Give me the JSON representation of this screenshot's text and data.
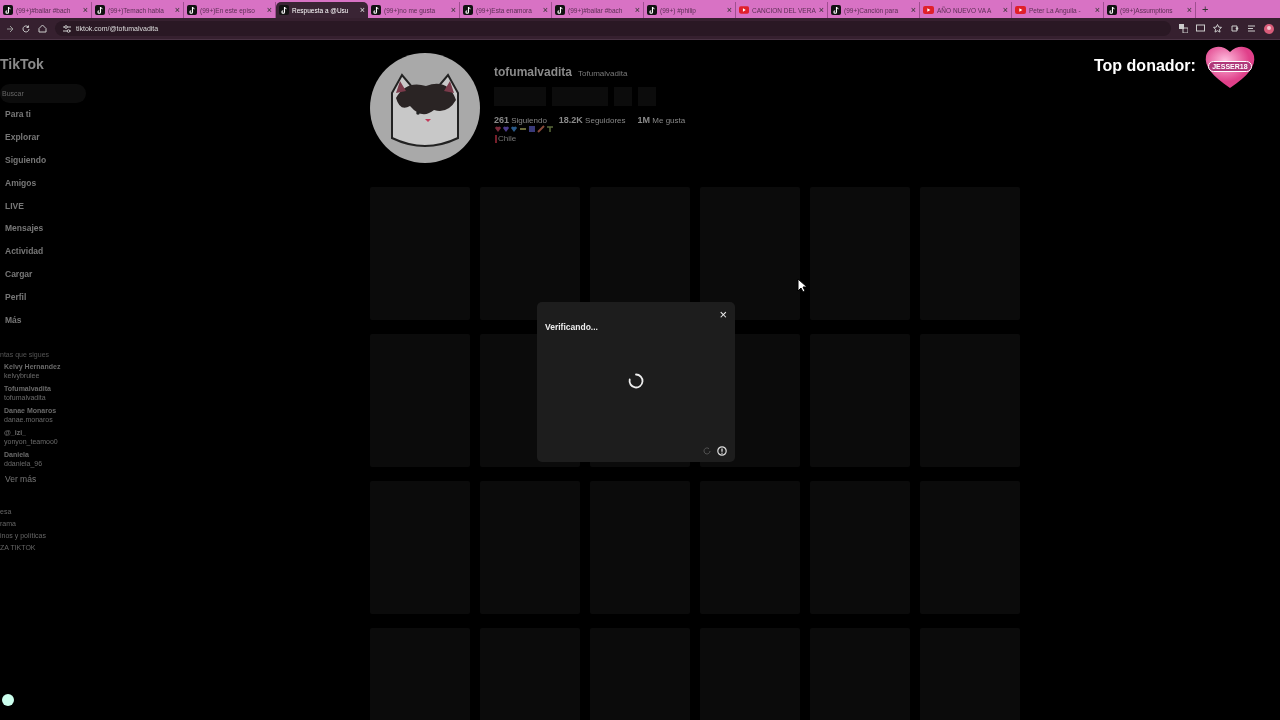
{
  "browser": {
    "tabs": [
      {
        "title": "(99+)#bailar #bach",
        "kind": "tiktok",
        "selected": false
      },
      {
        "title": "(99+)Temach habla",
        "kind": "tiktok",
        "selected": false
      },
      {
        "title": "(99+)En este episo",
        "kind": "tiktok",
        "selected": false
      },
      {
        "title": "Respuesta a @Usu",
        "kind": "tiktok",
        "selected": true
      },
      {
        "title": "(99+)no me gusta",
        "kind": "tiktok",
        "selected": false
      },
      {
        "title": "(99+)Esta enamora",
        "kind": "tiktok",
        "selected": false
      },
      {
        "title": "(99+)#bailar #bach",
        "kind": "tiktok",
        "selected": false
      },
      {
        "title": "(99+) #philip",
        "kind": "tiktok",
        "selected": false
      },
      {
        "title": "CANCION DEL VERA",
        "kind": "youtube",
        "selected": false
      },
      {
        "title": "(99+)Canción para",
        "kind": "tiktok",
        "selected": false
      },
      {
        "title": "AÑO NUEVO VA A",
        "kind": "youtube",
        "selected": false
      },
      {
        "title": "Peter La Anguila -",
        "kind": "youtube",
        "selected": false
      },
      {
        "title": "(99+)Assumptions",
        "kind": "tiktok",
        "selected": false
      }
    ],
    "close": "×",
    "new_tab": "+",
    "url": "tiktok.com/@tofumalvadita"
  },
  "sidebar": {
    "logo": "TikTok",
    "search": {
      "placeholder": "Buscar"
    },
    "nav": [
      "Para ti",
      "Explorar",
      "Siguiendo",
      "Amigos",
      "LIVE",
      "Mensajes",
      "Actividad",
      "Cargar",
      "Perfil",
      "Más"
    ],
    "following_title": "ntas que sigues",
    "following": [
      {
        "name": "Kelvy Hernandez",
        "handle": "kelvybrulee"
      },
      {
        "name": "Tofumalvadita",
        "handle": "tofumalvadita"
      },
      {
        "name": "Danae Monaros",
        "handle": "danae.monaros"
      },
      {
        "name": "@_izi_",
        "handle": "yonyon_teamoo0"
      },
      {
        "name": "Daniela",
        "handle": "ddaniela_96"
      }
    ],
    "see_more": "Ver más",
    "footer": [
      "esa",
      "rama",
      "inos y políticas",
      "ZA TIKTOK"
    ]
  },
  "profile": {
    "username": "tofumalvadita",
    "nickname": "Tofumalvadita",
    "stats": [
      "**261** Siguiendo",
      "**18.2K** Seguidores",
      "**1M** Me gusta"
    ],
    "location": "Chile"
  },
  "dialog": {
    "title": "Verificando...",
    "close": "×"
  },
  "overlay": {
    "label": "Top donador:",
    "donor": "JESSER18"
  }
}
